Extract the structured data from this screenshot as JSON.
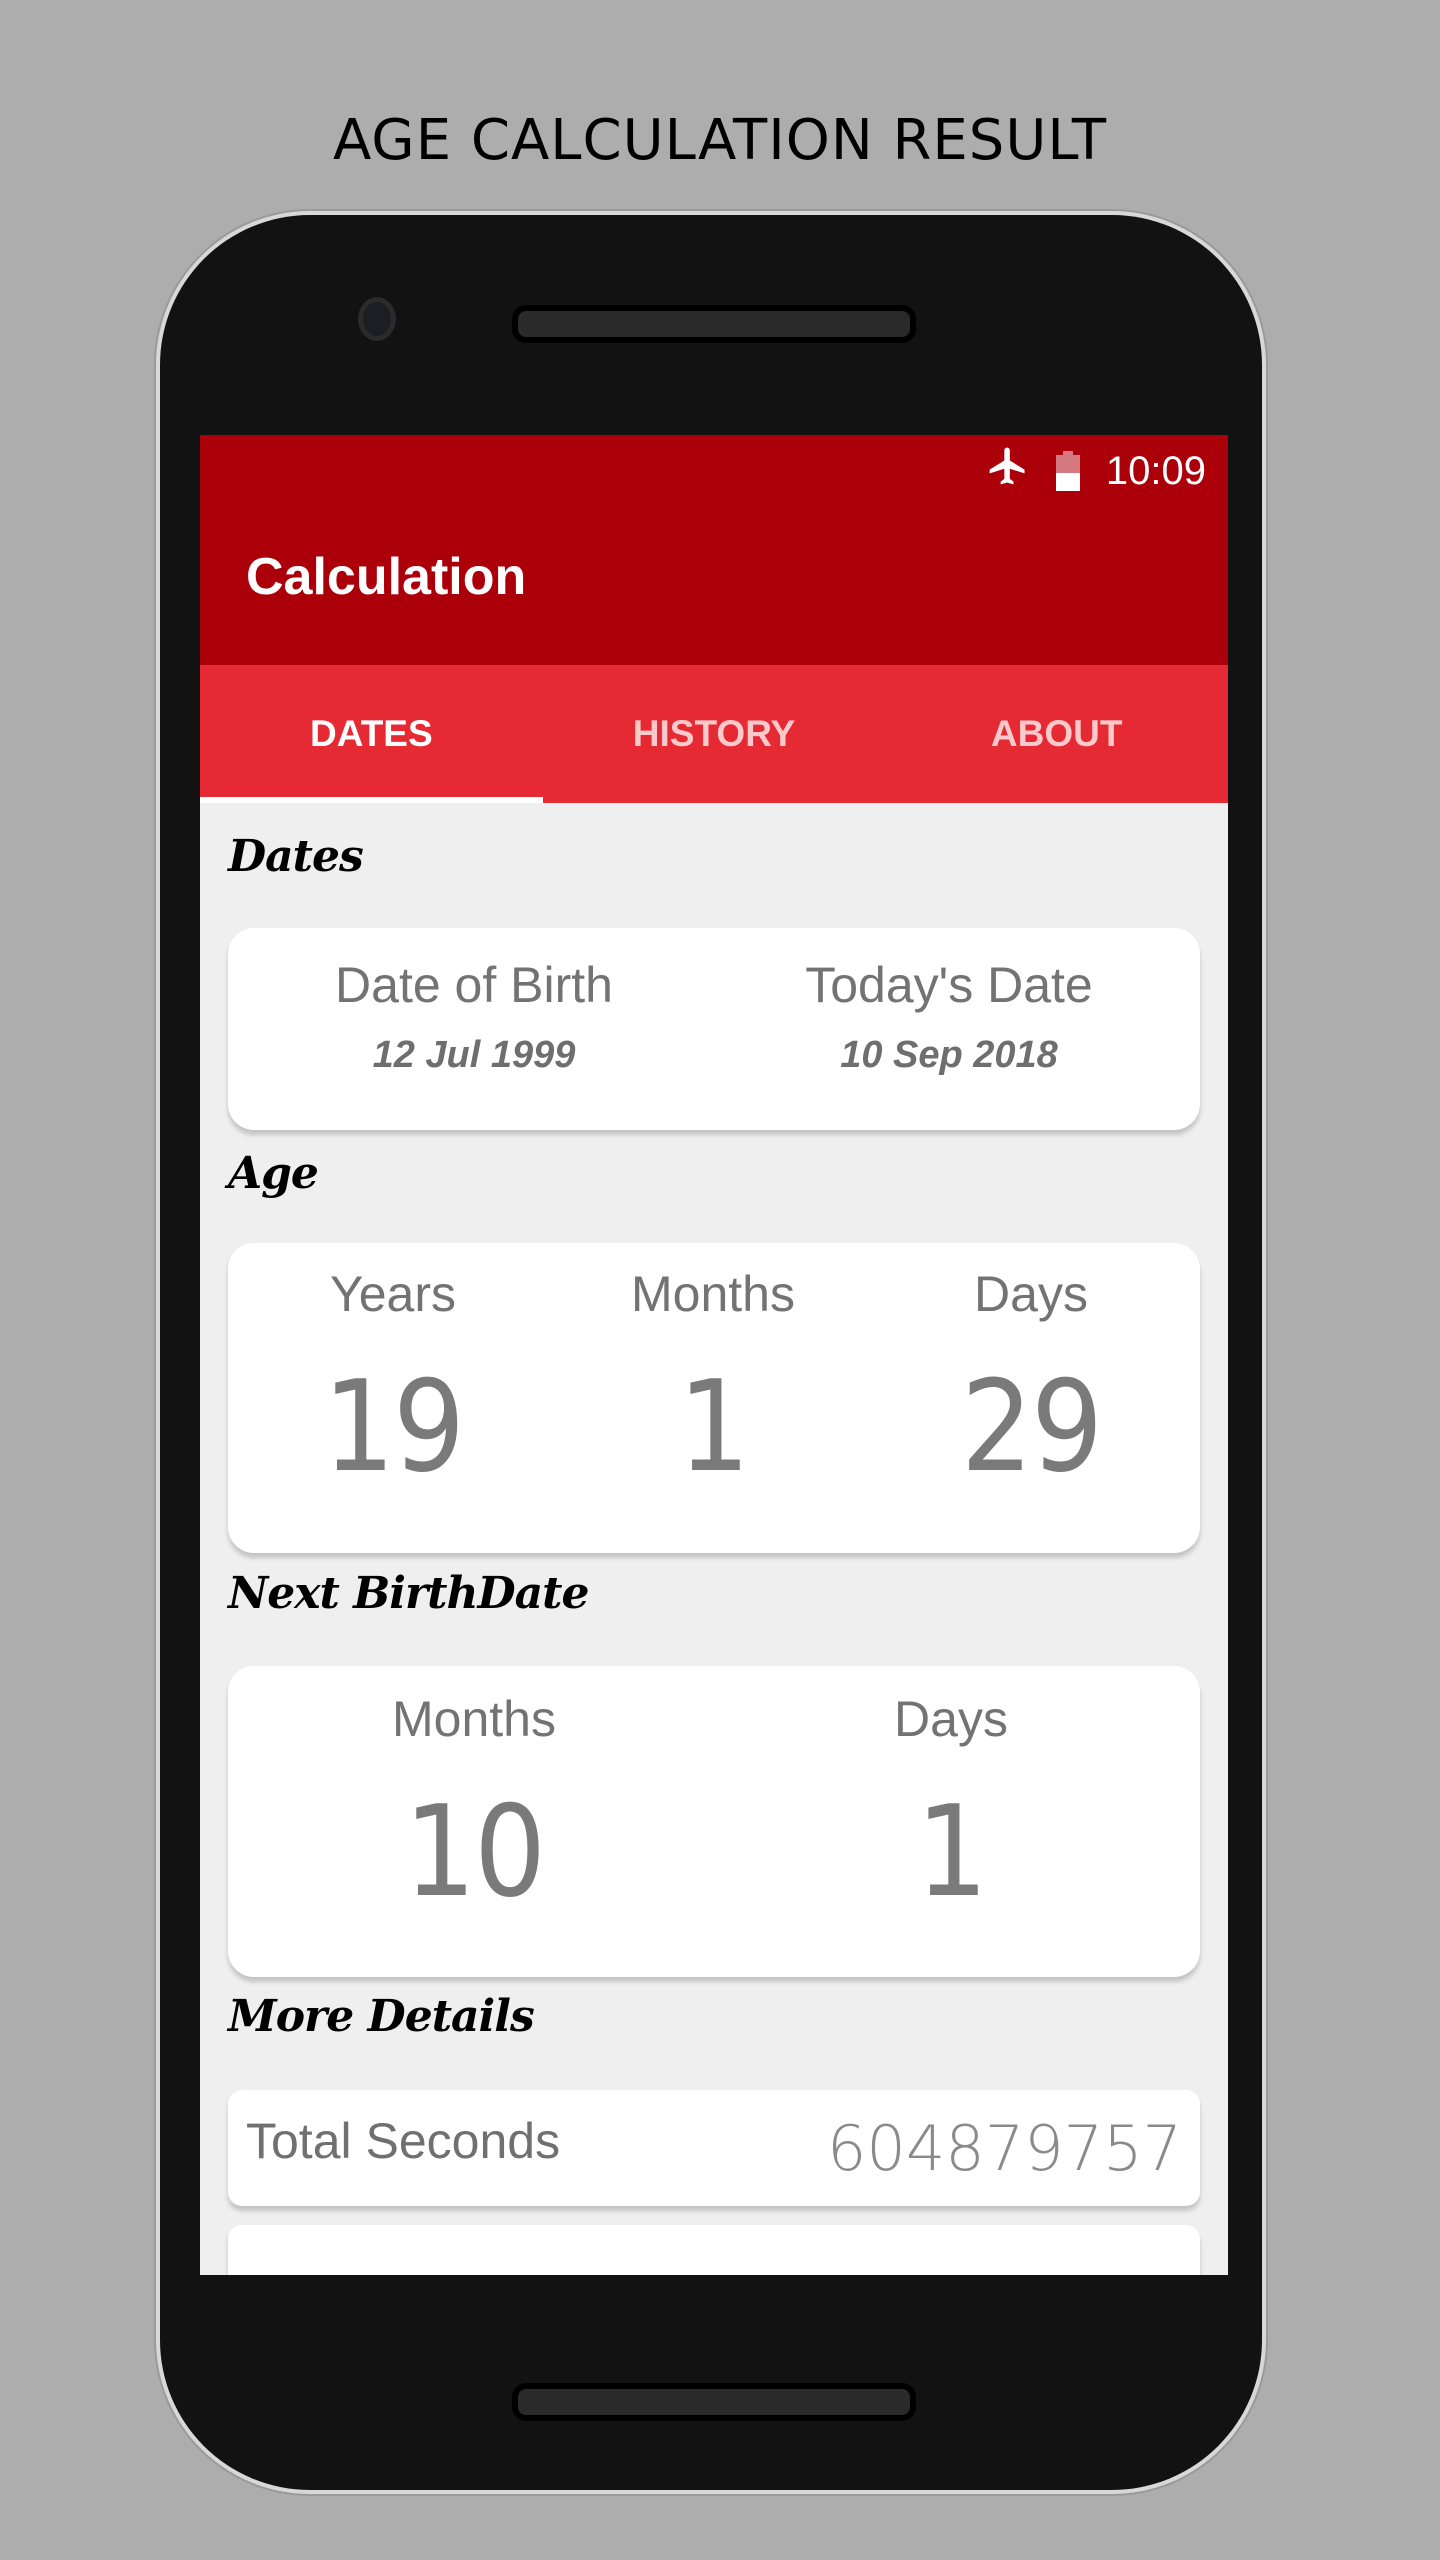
{
  "page_title": "AGE CALCULATION RESULT",
  "status_bar": {
    "icons": [
      "airplane-mode-icon",
      "battery-icon"
    ],
    "battery_level_percent": 50,
    "time": "10:09"
  },
  "app_bar": {
    "title": "Calculation"
  },
  "colors": {
    "primary_dark": "#ab000a",
    "primary": "#e62a33",
    "background": "#efefef"
  },
  "tabs": [
    {
      "label": "DATES",
      "active": true
    },
    {
      "label": "HISTORY",
      "active": false
    },
    {
      "label": "ABOUT",
      "active": false
    }
  ],
  "sections": {
    "dates": {
      "heading": "Dates",
      "birth_label": "Date of Birth",
      "birth_value": "12 Jul 1999",
      "today_label": "Today's Date",
      "today_value": "10 Sep 2018"
    },
    "age": {
      "heading": "Age",
      "years_label": "Years",
      "years_value": "19",
      "months_label": "Months",
      "months_value": "1",
      "days_label": "Days",
      "days_value": "29"
    },
    "next_birthdate": {
      "heading": "Next BirthDate",
      "months_label": "Months",
      "months_value": "10",
      "days_label": "Days",
      "days_value": "1"
    },
    "more_details": {
      "heading": "More Details",
      "rows": [
        {
          "label": "Total Seconds",
          "value": "604879757"
        }
      ]
    }
  }
}
